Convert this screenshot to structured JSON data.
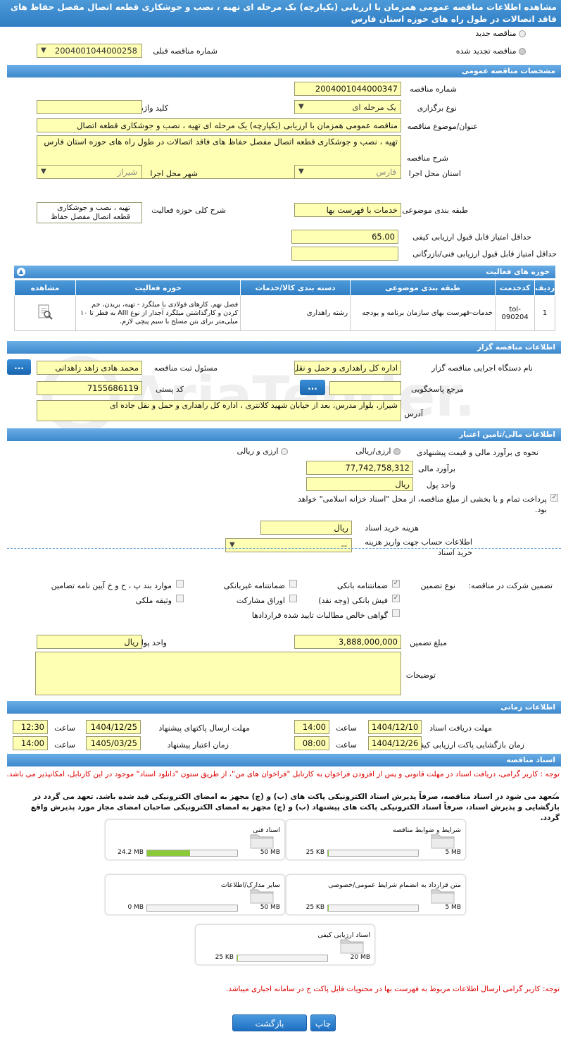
{
  "header": {
    "title": "مشاهده اطلاعات مناقصه عمومی همزمان با ارزیابی (یکپارچه) یک مرحله ای تهیه ، نصب و جوشکاری قطعه اتصال مفصل حفاظ های فاقد اتصالات در طول راه های حوزه استان فارس"
  },
  "top": {
    "new_label": "مناقصه جدید",
    "renewed_label": "مناقصه تجدید شده",
    "prev_number_label": "شماره مناقصه قبلی",
    "prev_number": "2004001044000258"
  },
  "general": {
    "section": "مشخصات مناقصه عمومی",
    "number_label": "شماره مناقصه",
    "number": "2004001044000347",
    "type_label": "نوع برگزاری",
    "type": "یک مرحله ای",
    "keyword_label": "کلید واژه",
    "keyword": "",
    "subject_label": "عنوان/موضوع مناقصه",
    "subject": "مناقصه عمومی همزمان با ارزیابی (یکپارچه) یک مرحله ای تهیه ، نصب و جوشکاری قطعه اتصال",
    "desc_label": "شرح مناقصه",
    "desc": "تهیه ، نصب و جوشکاری قطعه اتصال مفصل حفاظ های فاقد اتصالات در طول راه های حوزه استان فارس",
    "province_label": "استان محل اجرا",
    "province": "فارس",
    "city_label": "شهر محل اجرا",
    "city": "شیراز",
    "category_label": "طبقه بندی موضوعی",
    "category": "خدمات با فهرست بها",
    "scope_label": "شرح کلی حوزه فعالیت",
    "scope": "تهیه ، نصب و جوشکاری قطعه اتصال مفصل حفاظ",
    "min_quality_label": "حداقل امتیاز قابل قبول ارزیابی کیفی",
    "min_quality": "65.00",
    "min_tech_label": "حداقل امتیاز قابل قبول ارزیابی فنی/بازرگانی",
    "min_tech": ""
  },
  "activity": {
    "section": "حوزه های فعالیت",
    "columns": [
      "ردیف",
      "کدخدمت",
      "طبقه بندی موضوعی",
      "دسته بندی کالا/خدمات",
      "حوزه فعالیت",
      "مشاهده"
    ],
    "rows": [
      {
        "idx": "1",
        "code": "tol-090204",
        "cat": "خدمات-فهرست بهای سازمان برنامه و بودجه",
        "group": "رشته راهداری",
        "scope": "فصل نهم. کارهای فولادی با میلگرد - تهیه، بریدن، خم کردن و کارگذاشتن میلگرد آجدار از نوع AIII به قطر تا ۱۰ میلی‌متر برای بتن مسلح با سیم پیچی لازم."
      }
    ]
  },
  "organizer": {
    "section": "اطلاعات مناقصه گزار",
    "agency_label": "نام دستگاه اجرایی مناقصه گزار",
    "agency": "اداره کل راهداری و حمل و نقل جاده ای",
    "officer_label": "مسئول ثبت مناقصه",
    "officer": "محمد هادی  زاهد زاهدانی",
    "ref_label": "مرجع پاسخگویی",
    "ref": "",
    "postal_label": "کد پستی",
    "postal": "7155686119",
    "address_label": "آدرس",
    "address": "شیراز، بلوار مدرس، بعد از خیابان شهید کلانتری ، اداره کل راهداری و حمل و نقل جاده ای",
    "btn": "..."
  },
  "finance": {
    "section": "اطلاعات مالی/تامین اعتبار",
    "method_label": "نحوه ی برآورد مالی و قیمت پیشنهادی",
    "opt1": "ارزی/ریالی",
    "opt2": "ارزی و ریالی",
    "estimate_label": "برآورد مالی",
    "estimate": "77,742,758,312",
    "currency_label": "واحد پول",
    "currency": "ریال",
    "treasury_text": "پرداخت تمام و یا بخشی از مبلغ مناقصه، از محل \"اسناد خزانه اسلامی\" خواهد بود.",
    "doc_cost_label": "هزینه خرید اسناد",
    "doc_cost": "ریال",
    "account_label": "اطلاعات حساب جهت واریز هزینه خرید اسناد",
    "account": "--"
  },
  "guarantee": {
    "label": "تضمین شرکت در مناقصه:",
    "type_label": "نوع تضمین",
    "items": [
      "ضمانتنامه بانکی",
      "ضمانتنامه غیربانکی",
      "موارد بند پ ، ح و خ آیین نامه تضامین",
      "فیش بانکی (وجه نقد)",
      "اوراق مشارکت",
      "وثیقه ملکی",
      "گواهی خالص مطالبات تایید شده قراردادها"
    ],
    "amount_label": "مبلغ تضمین",
    "amount": "3,888,000,000",
    "currency_label": "واحد پول",
    "currency": "ریال",
    "notes_label": "توضیحات",
    "notes": ""
  },
  "timing": {
    "section": "اطلاعات زمانی",
    "receive_label": "مهلت دریافت اسناد",
    "receive_date": "1404/12/10",
    "receive_time": "14:00",
    "send_label": "مهلت ارسال پاکتهای پیشنهاد",
    "send_date": "1404/12/25",
    "send_time": "12:30",
    "open_label": "زمان بازگشایی پاکت ارزیابی کیفی",
    "open_date": "1404/12/26",
    "open_time": "08:00",
    "valid_label": "زمان اعتبار پیشنهاد",
    "valid_date": "1405/03/25",
    "valid_time": "14:00",
    "time_label": "ساعت"
  },
  "docs": {
    "section": "اسناد مناقصه",
    "note": "توجه : کاربر گرامی، دریافت اسناد در مهلت قانونی و پس از افزودن فراخوان به کارتابل \"فراخوان های من\"، از طریق ستون \"دانلود اسناد\" موجود در این کارتابل، امکانپذیر می باشد.",
    "commit": "متعهد می شود در اسناد مناقصه، صرفاً پذیرش اسناد الکترونیکی پاکت های (ب) و (ج) مجهز به امضای الکترونیکی قید شده باشد. تعهد می گردد در بازگشایی و پذیرش اسناد، صرفاً اسناد الکترونیکی پاکت های پیشنهاد (ب) و (ج) مجهز به امضای الکترونیکی صاحبان امضای مجاز مورد پذیرش واقع گردد.",
    "files": [
      {
        "title": "شرایط و ضوابط مناقصه",
        "current": "25 KB",
        "max": "5 MB",
        "pct": 1
      },
      {
        "title": "اسناد فنی",
        "current": "24.2 MB",
        "max": "50 MB",
        "pct": 48
      },
      {
        "title": "متن قرارداد به انضمام شرایط عمومی/خصوصی",
        "current": "25 KB",
        "max": "5 MB",
        "pct": 1
      },
      {
        "title": "سایر مدارک/اطلاعات",
        "current": "0 MB",
        "max": "50 MB",
        "pct": 0
      },
      {
        "title": "اسناد ارزیابی کیفی",
        "current": "25 KB",
        "max": "20 MB",
        "pct": 1
      }
    ],
    "footer_note": "توجه: کاربر گرامی ارسال اطلاعات مربوط به فهرست بها در محتویات فایل پاکت ج در سامانه اجباری میباشد."
  },
  "actions": {
    "print": "چاپ",
    "back": "بازگشت"
  },
  "watermark": "AriaTender.neT"
}
